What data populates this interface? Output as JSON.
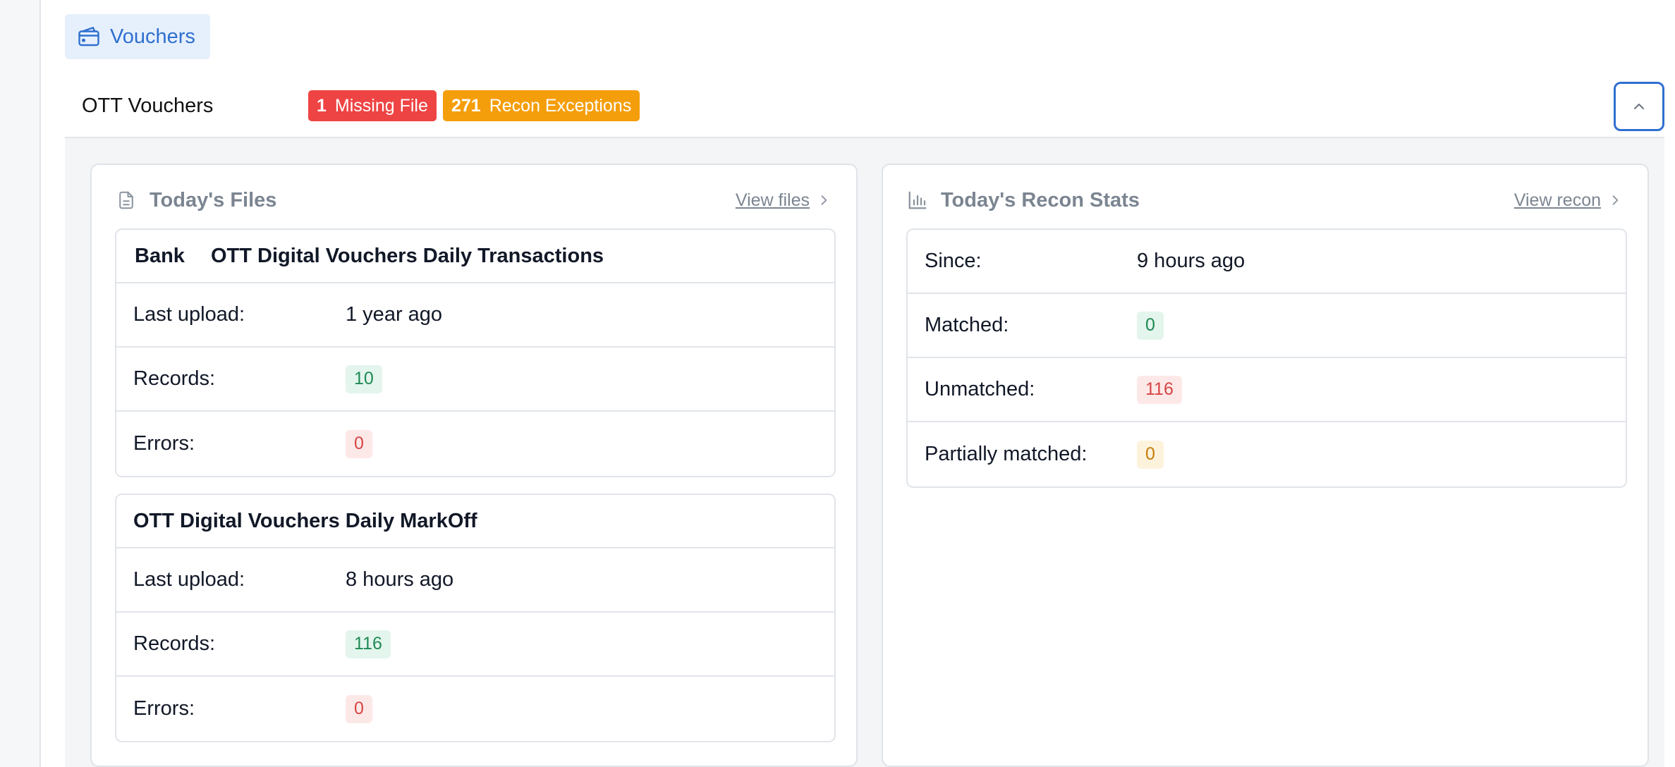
{
  "page": {
    "tag_label": "Vouchers",
    "tag_icon": "wallet-icon"
  },
  "section": {
    "title": "OTT Vouchers",
    "badges": [
      {
        "count": "1",
        "label": "Missing File",
        "color": "#ef4444"
      },
      {
        "count": "271",
        "label": "Recon Exceptions",
        "color": "#f59e0b"
      }
    ],
    "collapse_icon": "chevron-up-icon"
  },
  "files_card": {
    "title": "Today's Files",
    "icon": "document-icon",
    "link": "View files",
    "files": [
      {
        "source": "Bank",
        "name": "OTT Digital Vouchers Daily Transactions",
        "last_upload_label": "Last upload:",
        "last_upload": "1 year ago",
        "records_label": "Records:",
        "records": "10",
        "errors_label": "Errors:",
        "errors": "0"
      },
      {
        "source": "",
        "name": "OTT Digital Vouchers Daily MarkOff",
        "last_upload_label": "Last upload:",
        "last_upload": "8 hours ago",
        "records_label": "Records:",
        "records": "116",
        "errors_label": "Errors:",
        "errors": "0"
      }
    ]
  },
  "recon_card": {
    "title": "Today's Recon Stats",
    "icon": "bar-chart-icon",
    "link": "View recon",
    "since_label": "Since:",
    "since": "9 hours ago",
    "matched_label": "Matched:",
    "matched": "0",
    "unmatched_label": "Unmatched:",
    "unmatched": "116",
    "partial_label": "Partially matched:",
    "partial": "0"
  },
  "colors": {
    "accent": "#2f6fd0",
    "success": "#1f8a55",
    "danger": "#d64545",
    "warning": "#c77a0a"
  }
}
